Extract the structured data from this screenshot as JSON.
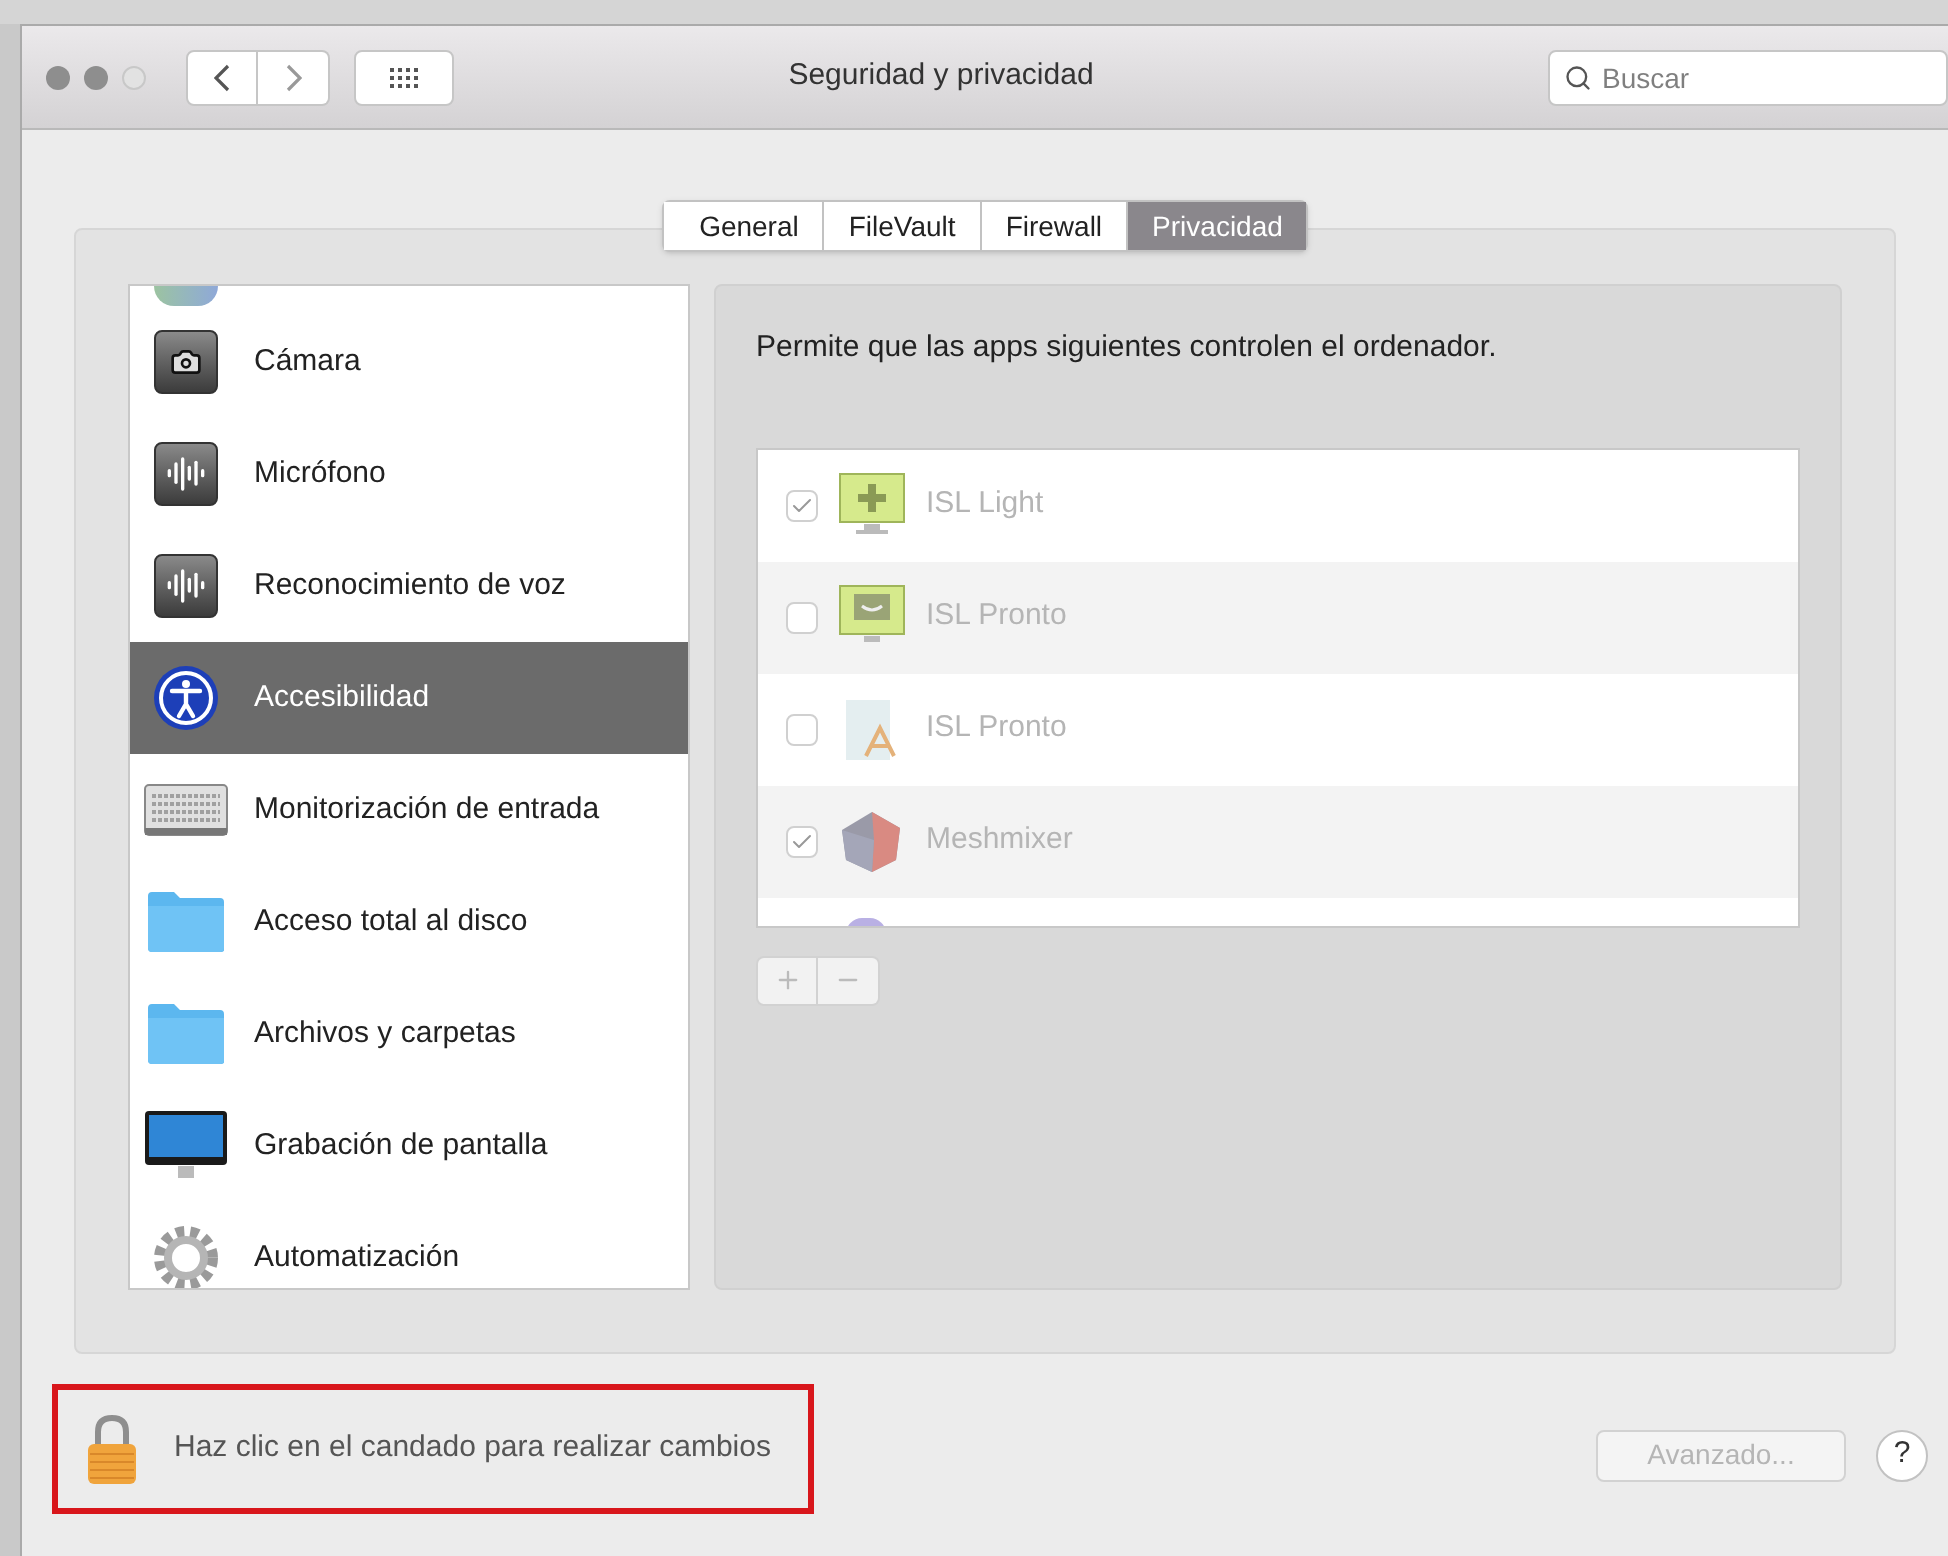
{
  "window": {
    "title": "Seguridad y privacidad"
  },
  "search": {
    "placeholder": "Buscar"
  },
  "tabs": [
    {
      "label": "General",
      "selected": false
    },
    {
      "label": "FileVault",
      "selected": false
    },
    {
      "label": "Firewall",
      "selected": false
    },
    {
      "label": "Privacidad",
      "selected": true
    }
  ],
  "sidebar": {
    "items": [
      {
        "kind": "camera",
        "label": "Cámara",
        "selected": false
      },
      {
        "kind": "waveform",
        "label": "Micrófono",
        "selected": false
      },
      {
        "kind": "waveform",
        "label": "Reconocimiento de voz",
        "selected": false
      },
      {
        "kind": "accessibility",
        "label": "Accesibilidad",
        "selected": true
      },
      {
        "kind": "keyboard",
        "label": "Monitorización de entrada",
        "selected": false
      },
      {
        "kind": "folder",
        "label": "Acceso total al disco",
        "selected": false
      },
      {
        "kind": "folder",
        "label": "Archivos y carpetas",
        "selected": false
      },
      {
        "kind": "monitor",
        "label": "Grabación de pantalla",
        "selected": false
      },
      {
        "kind": "gear",
        "label": "Automatización",
        "selected": false
      }
    ]
  },
  "description": "Permite que las apps siguientes controlen el ordenador.",
  "apps": [
    {
      "kind": "plus-monitor",
      "name": "ISL Light",
      "checked": true
    },
    {
      "kind": "chat-monitor",
      "name": "ISL Pronto",
      "checked": false
    },
    {
      "kind": "installer",
      "name": "ISL Pronto",
      "checked": false
    },
    {
      "kind": "polyhedron",
      "name": "Meshmixer",
      "checked": true
    }
  ],
  "lock_message": "Haz clic en el candado para realizar cambios",
  "advanced_button": {
    "label": "Avanzado...",
    "disabled": true
  },
  "help_button": {
    "label": "?"
  }
}
